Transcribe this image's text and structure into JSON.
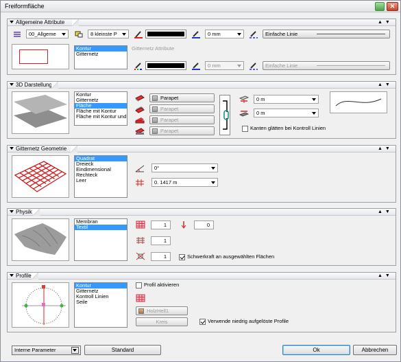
{
  "window": {
    "title": "Freiformfläche"
  },
  "sections": {
    "allgemeine": {
      "title": "Allgemeine Attribute"
    },
    "darstellung": {
      "title": "3D Darstellung"
    },
    "geometrie": {
      "title": "Gitternetz Geometrie"
    },
    "physik": {
      "title": "Physik"
    },
    "profile": {
      "title": "Profile"
    }
  },
  "allgemeine": {
    "layer": "00_Allgeme",
    "pen": "8 kleinste P",
    "width_top": "0 mm",
    "linetype_top": "Einfache Linie",
    "list": [
      "Kontur",
      "Gitternetz"
    ],
    "selected": 0,
    "gitternetz_label": "Gitternetz Attribute",
    "width_bottom": "0 mm",
    "linetype_bottom": "Einfache Linie"
  },
  "darstellung": {
    "list": [
      "Kontur",
      "Gitternetz",
      "Fläche",
      "Fläche mit Kontur",
      "Fläche mit Kontur und"
    ],
    "selected": 2,
    "materials": [
      "Parapet",
      "Parapet",
      "Parapet",
      "Parapet"
    ],
    "offset1": "0 m",
    "offset2": "0 m",
    "smooth_label": "Kanten glätten bei Kontroll Linien"
  },
  "geometrie": {
    "list": [
      "Quadrat",
      "Dreieck",
      "Eindimensional",
      "Rechteck",
      "Leer"
    ],
    "selected": 0,
    "angle": "0°",
    "spacing": "0. 1417 m"
  },
  "physik": {
    "list": [
      "Membran",
      "Textil"
    ],
    "selected": 1,
    "v1": "1",
    "v2": "0",
    "v3": "1",
    "v4": "1",
    "gravity_label": "Schwerkraft an ausgewählten Flächen"
  },
  "profile": {
    "list": [
      "Kontur",
      "Gitternetz",
      "Kontroll Linien",
      "Seile"
    ],
    "selected": 0,
    "activate_label": "Profil aktivieren",
    "material": "HolzHell1",
    "shape": "Kreis",
    "lowres_label": "Verwende niedrig aufgelöste Profile"
  },
  "footer": {
    "params": "Interne Parameter",
    "standard": "Standard",
    "ok": "Ok",
    "cancel": "Abbrechen"
  }
}
